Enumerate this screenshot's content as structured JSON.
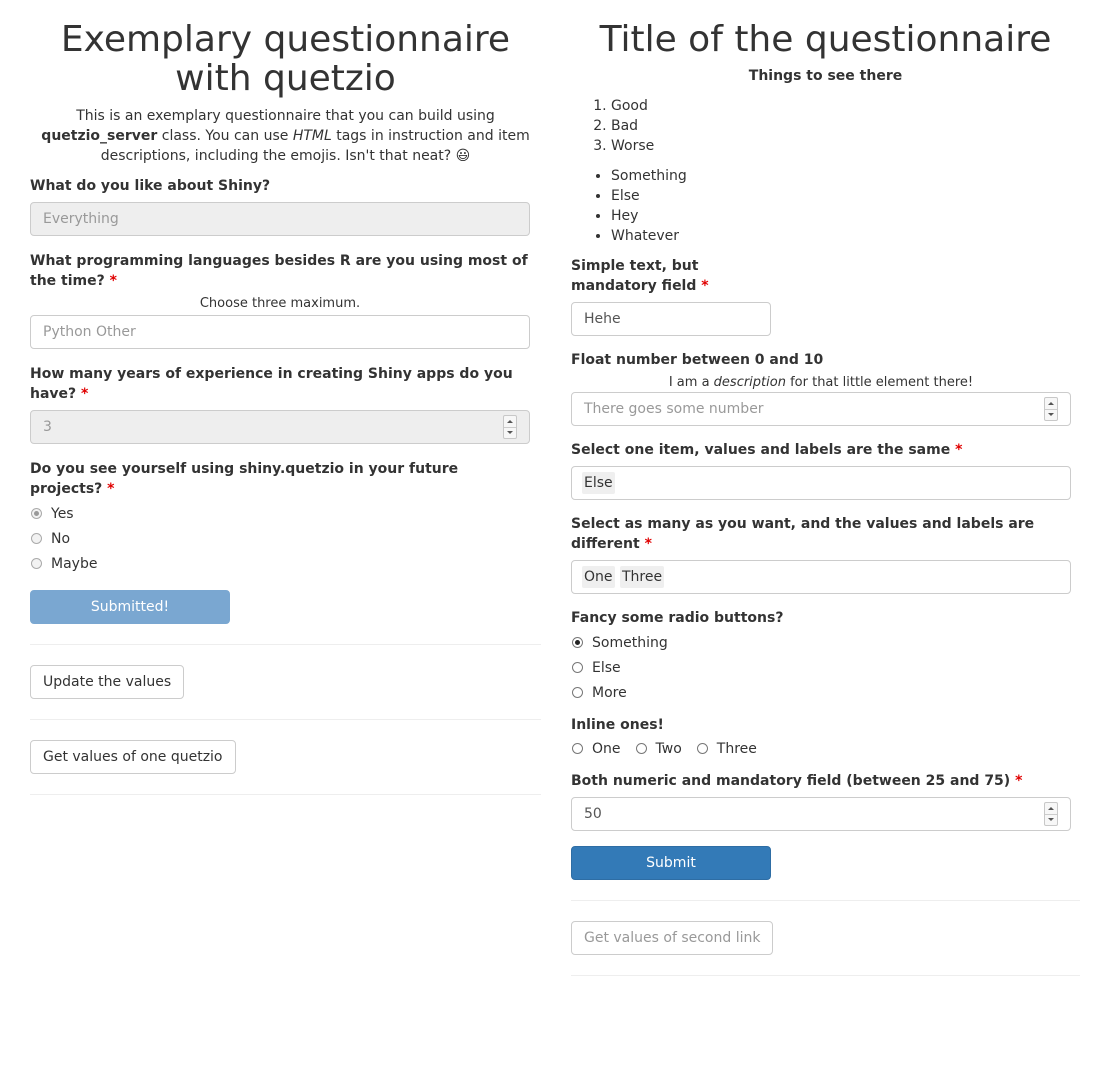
{
  "left": {
    "title": "Exemplary questionnaire with quetzio",
    "description": {
      "part1": "This is an exemplary questionnaire that you can build using ",
      "bold": "quetzio_server",
      "part2": " class. You can use ",
      "italic": "HTML",
      "part3": " tags in instruction and item descriptions, including the emojis. Isn't that neat? 😃"
    },
    "q1": {
      "label": "What do you like about Shiny?",
      "value": "Everything"
    },
    "q2": {
      "label": "What programming languages besides R are you using most of the time?",
      "required": "*",
      "note": "Choose three maximum.",
      "placeholder": "Python  Other"
    },
    "q3": {
      "label": "How many years of experience in creating Shiny apps do you have?",
      "required": "*",
      "value": "3"
    },
    "q4": {
      "label": "Do you see yourself using shiny.quetzio in your future projects?",
      "required": "*",
      "options": [
        "Yes",
        "No",
        "Maybe"
      ],
      "selected": "Yes"
    },
    "submit_label": "Submitted!",
    "update_label": "Update the values",
    "get_values_label": "Get values of one quetzio"
  },
  "right": {
    "title": "Title of the questionnaire",
    "subtitle": "Things to see there",
    "ordered": [
      "Good",
      "Bad",
      "Worse"
    ],
    "bullets": [
      "Something",
      "Else",
      "Hey",
      "Whatever"
    ],
    "q1": {
      "label": "Simple text, but mandatory field",
      "required": "*",
      "value": "Hehe"
    },
    "q2": {
      "label": "Float number between 0 and 10",
      "note_pre": "I am a ",
      "note_em": "description",
      "note_post": " for that little element there!",
      "placeholder": "There goes some number"
    },
    "q3": {
      "label": "Select one item, values and labels are the same",
      "required": "*",
      "value": "Else"
    },
    "q4": {
      "label": "Select as many as you want, and the values and labels are different",
      "required": "*",
      "values": [
        "One",
        "Three"
      ]
    },
    "q5": {
      "label": "Fancy some radio buttons?",
      "options": [
        "Something",
        "Else",
        "More"
      ],
      "selected": "Something"
    },
    "q6": {
      "label": "Inline ones!",
      "options": [
        "One",
        "Two",
        "Three"
      ]
    },
    "q7": {
      "label": "Both numeric and mandatory field (between 25 and 75)",
      "required": "*",
      "value": "50"
    },
    "submit_label": "Submit",
    "get_values_label": "Get values of second link"
  }
}
